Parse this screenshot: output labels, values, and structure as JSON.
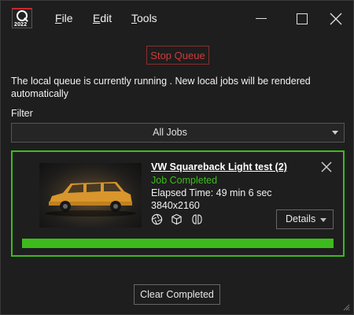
{
  "app": {
    "logo_year": "2022"
  },
  "menu": {
    "file": {
      "accel": "F",
      "rest": "ile"
    },
    "edit": {
      "accel": "E",
      "rest": "dit"
    },
    "tools": {
      "accel": "T",
      "rest": "ools"
    }
  },
  "queue": {
    "stop_label": "Stop Queue",
    "status_text": "The local queue is currently running .  New local jobs will be rendered automatically",
    "filter_label": "Filter",
    "filter_value": "All Jobs"
  },
  "job": {
    "title": "VW Squareback Light test (2)",
    "status": "Job Completed",
    "elapsed": "Elapsed Time: 49 min 6 sec",
    "resolution": "3840x2160",
    "details_label": "Details",
    "progress_fraction": 1.0,
    "icons": [
      "aperture-icon",
      "cube-icon",
      "split-bracket-icon"
    ]
  },
  "actions": {
    "clear_completed_label": "Clear Completed"
  },
  "colors": {
    "accent_green": "#3dbb1c",
    "stop_red": "#d23a3a",
    "background": "#1e1e1e"
  }
}
